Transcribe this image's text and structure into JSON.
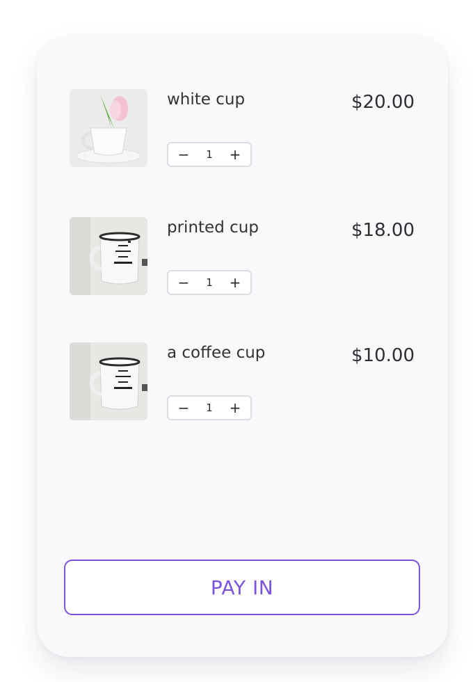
{
  "cart": {
    "items": [
      {
        "name": "white cup",
        "price": "$20.00",
        "quantity": "1",
        "decrement": "−",
        "increment": "+"
      },
      {
        "name": "printed cup",
        "price": "$18.00",
        "quantity": "1",
        "decrement": "−",
        "increment": "+"
      },
      {
        "name": "a coffee cup",
        "price": "$10.00",
        "quantity": "1",
        "decrement": "−",
        "increment": "+"
      }
    ],
    "pay_label": "PAY IN"
  },
  "colors": {
    "accent": "#7c52e0",
    "card_bg": "#f9f9fc",
    "text": "#2f2f33"
  }
}
